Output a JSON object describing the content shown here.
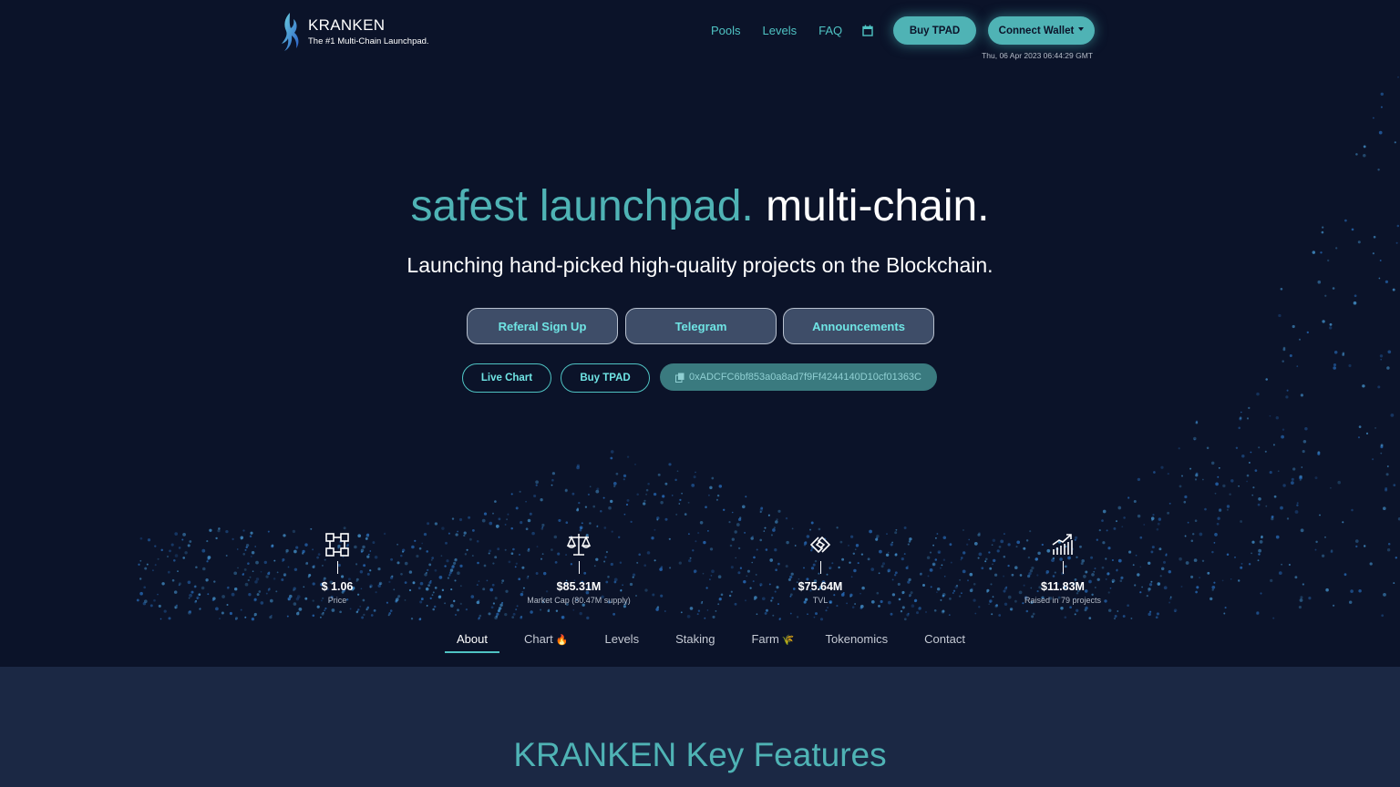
{
  "header": {
    "brand_name": "KRANKEN",
    "tagline": "The #1 Multi-Chain Launchpad.",
    "nav": [
      "Pools",
      "Levels",
      "FAQ"
    ],
    "buy_label": "Buy TPAD",
    "wallet_label": "Connect Wallet",
    "datetime": "Thu, 06 Apr 2023 06:44:29 GMT"
  },
  "hero": {
    "headline_a": "safest launchpad.",
    "headline_b": "multi-chain.",
    "subline": "Launching hand-picked high-quality projects on the Blockchain.",
    "buttons": [
      "Referal Sign Up",
      "Telegram",
      "Announcements"
    ],
    "small_buttons": [
      "Live Chart",
      "Buy TPAD"
    ],
    "contract": "0xADCFC6bf853a0a8ad7f9Ff4244140D10cf01363C"
  },
  "stats": [
    {
      "icon": "blocks-icon",
      "value": "$ 1.06",
      "label": "Price"
    },
    {
      "icon": "scale-icon",
      "value": "$85.31M",
      "label": "Market Cap (80.47M supply)"
    },
    {
      "icon": "link-icon",
      "value": "$75.64M",
      "label": "TVL"
    },
    {
      "icon": "growth-chart-icon",
      "value": "$11.83M",
      "label": "Raised in 79 projects"
    }
  ],
  "tabs": [
    {
      "label": "About",
      "emoji": ""
    },
    {
      "label": "Chart",
      "emoji": "🔥"
    },
    {
      "label": "Levels",
      "emoji": ""
    },
    {
      "label": "Staking",
      "emoji": ""
    },
    {
      "label": "Farm",
      "emoji": "🌾"
    },
    {
      "label": "Tokenomics",
      "emoji": ""
    },
    {
      "label": "Contact",
      "emoji": ""
    }
  ],
  "features": {
    "title_a": "KRANKEN",
    "title_b": "Key Features"
  },
  "colors": {
    "background": "#0b1329",
    "accent": "#4fb3b5",
    "section": "#1b2844"
  }
}
